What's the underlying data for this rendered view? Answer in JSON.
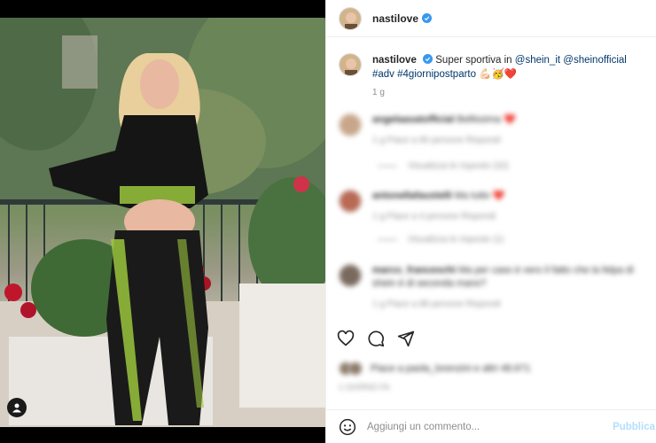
{
  "colors": {
    "accent": "#0095f6",
    "text": "#262626",
    "muted": "#8e8e8e",
    "link": "#00376b",
    "verified": "#3897f0",
    "heart": "#ed4956"
  },
  "post": {
    "username": "nastilove",
    "caption": {
      "username": "nastilove",
      "text_before": "Super sportiva in ",
      "mention1": "@shein_it",
      "mention2": "@sheinofficial",
      "tag1": "#adv",
      "tag2": "#4giornipostparto",
      "emojis": "💪🏻🥳❤️",
      "time": "1 g"
    },
    "comments": [
      {
        "username": "angelaasatofficial",
        "text": "Bellissima ❤️",
        "meta": "1 g   Piace a 90 persone   Rispondi",
        "replies": "Visualizza le risposte (32)"
      },
      {
        "username": "antonellafaustelli",
        "text": "Ma tutto ❤️",
        "meta": "1 g   Piace a 4 persone   Rispondi",
        "replies": "Visualizza le risposte (1)"
      },
      {
        "username": "marco_franceschi",
        "text": "Ma per caso è vero il fatto che la felpa di shein è di seconda mano?",
        "meta": "1 g   Piace a 88 persone   Rispondi"
      }
    ],
    "likes_text": "Piace a paola_lorenzini e altri 48.671",
    "date": "1 GIORNO FA"
  },
  "add_comment": {
    "placeholder": "Aggiungi un commento...",
    "publish_label": "Pubblica"
  },
  "icons": [
    "heart-icon",
    "comment-icon",
    "share-icon",
    "emoji-icon",
    "verified-icon",
    "user-tag-icon"
  ]
}
